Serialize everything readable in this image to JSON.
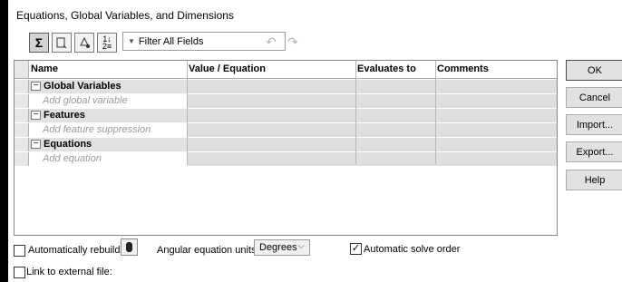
{
  "window": {
    "title": "Equations, Global Variables, and Dimensions"
  },
  "toolbar": {
    "buttons": [
      {
        "icon": "sigma-equation-view-icon",
        "active": true
      },
      {
        "icon": "sketch-equation-view-icon",
        "active": false
      },
      {
        "icon": "dimension-view-icon",
        "active": false
      },
      {
        "icon": "ordered-view-icon",
        "active": false
      }
    ],
    "filter_placeholder": "Filter All Fields",
    "undo_icon": "undo-icon",
    "redo_icon": "redo-icon"
  },
  "grid": {
    "columns": [
      "Name",
      "Value / Equation",
      "Evaluates to",
      "Comments"
    ],
    "groups": [
      {
        "label": "Global Variables",
        "add_label": "Add global variable"
      },
      {
        "label": "Features",
        "add_label": "Add feature suppression"
      },
      {
        "label": "Equations",
        "add_label": "Add equation"
      }
    ]
  },
  "buttons": {
    "ok": "OK",
    "cancel": "Cancel",
    "import": "Import...",
    "export": "Export...",
    "help": "Help"
  },
  "options": {
    "auto_rebuild": {
      "label": "Automatically rebuild",
      "checked": false
    },
    "angular_units_label": "Angular equation units:",
    "angular_units_value": "Degrees",
    "auto_solve_order": {
      "label": "Automatic solve order",
      "checked": true
    },
    "link_external": {
      "label": "Link to external file:",
      "checked": false
    }
  }
}
